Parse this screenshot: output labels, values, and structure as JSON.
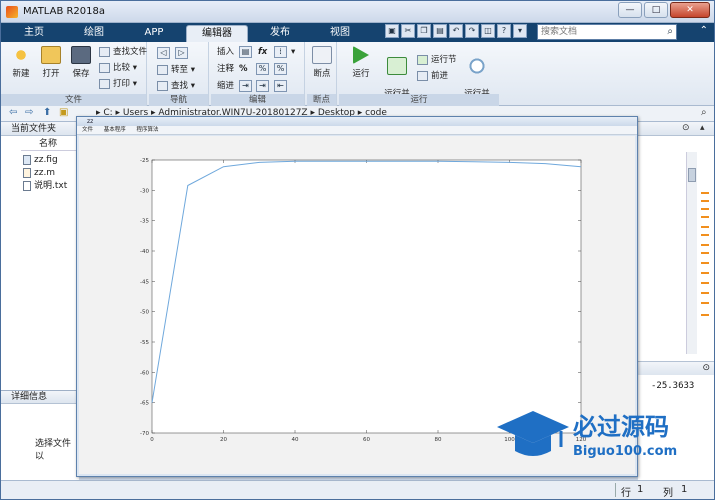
{
  "window": {
    "title": "MATLAB R2018a",
    "min": "—",
    "max": "□",
    "close": "✕"
  },
  "tabs": [
    {
      "label": "主页",
      "active": false
    },
    {
      "label": "绘图",
      "active": false
    },
    {
      "label": "APP",
      "active": false
    },
    {
      "label": "编辑器",
      "active": true
    },
    {
      "label": "发布",
      "active": false
    },
    {
      "label": "视图",
      "active": false
    }
  ],
  "search": {
    "placeholder": "搜索文档"
  },
  "ribbon": {
    "file": {
      "group": "文件",
      "new": "新建",
      "open": "打开",
      "save": "保存",
      "find_files": "查找文件",
      "compare": "比较",
      "print": "打印"
    },
    "nav": {
      "group": "导航",
      "goto": "转至",
      "find": "查找"
    },
    "edit": {
      "group": "编辑",
      "insert": "插入",
      "fx": "fx",
      "comment": "注释",
      "comment_sym": "%",
      "indent": "缩进"
    },
    "breakpoints": {
      "group": "断点",
      "label": "断点"
    },
    "run": {
      "group": "运行",
      "run": "运行",
      "run_advance": "运行并\n前进",
      "run_section": "运行节",
      "advance": "前进",
      "run_time": "运行并\n计时"
    }
  },
  "address": {
    "path": "▸  C:  ▸  Users  ▸  Administrator.WIN7U-20180127Z  ▸  Desktop  ▸  code"
  },
  "current_folder": {
    "title": "当前文件夹",
    "column": "名称",
    "files": [
      "zz.fig",
      "zz.m",
      "说明.txt"
    ]
  },
  "details": {
    "title": "详细信息",
    "text": "选择文件以"
  },
  "workspace": {
    "value": "-25.3633"
  },
  "status": {
    "row_label": "行",
    "row": "1",
    "col_label": "列",
    "col": "1"
  },
  "figure": {
    "title": "zz",
    "menu": [
      "文件",
      "基本程序",
      "程序算法"
    ]
  },
  "chart_data": {
    "type": "line",
    "x": [
      0,
      10,
      20,
      30,
      40,
      50,
      60,
      70,
      80,
      90,
      100,
      110,
      120
    ],
    "y": [
      -65,
      -29.2,
      -26.1,
      -25.4,
      -25.2,
      -25.2,
      -25.2,
      -25.2,
      -25.2,
      -25.3,
      -25.4,
      -25.6,
      -26.1
    ],
    "xlim": [
      0,
      120
    ],
    "ylim": [
      -70,
      -25
    ],
    "xticks": [
      0,
      20,
      40,
      60,
      80,
      100,
      120
    ],
    "yticks": [
      -25,
      -30,
      -35,
      -40,
      -45,
      -50,
      -55,
      -60,
      -65,
      -70
    ],
    "grid": false,
    "color": "#6fa8dc",
    "title": "",
    "xlabel": "",
    "ylabel": ""
  },
  "logo": {
    "text_cn": "必过源码",
    "text_en": "Biguo100.com"
  }
}
